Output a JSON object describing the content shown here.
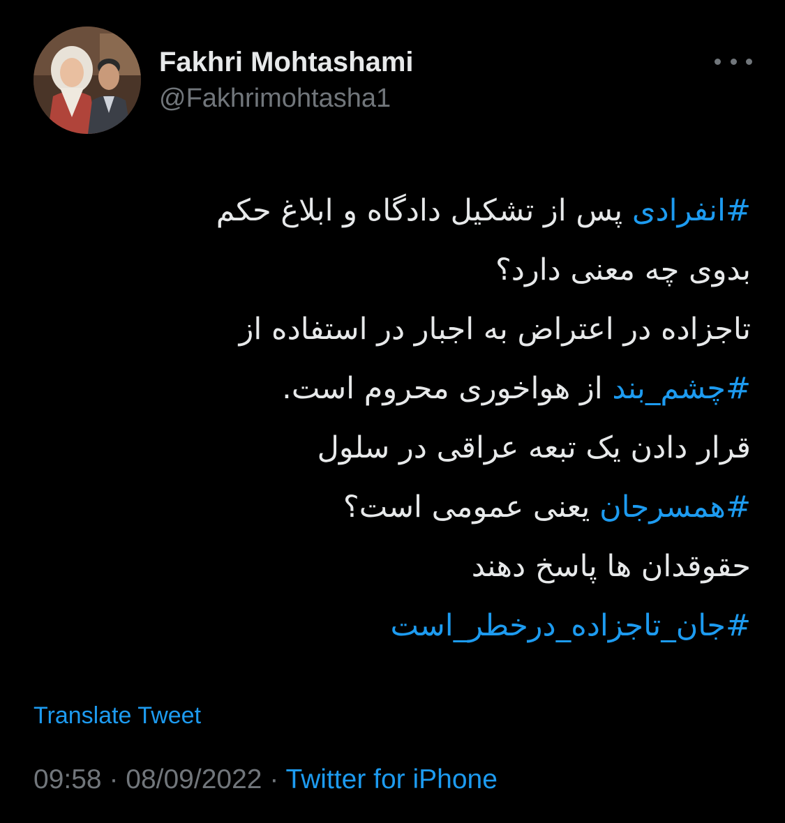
{
  "author": {
    "display_name": "Fakhri Mohtashami",
    "handle": "@Fakhrimohtasha1",
    "avatar_icon": "profile-photo-icon"
  },
  "more_icon": "more-horizontal-icon",
  "tweet": {
    "lines": [
      {
        "hashtag": "#انفرادی",
        "text": " پس از تشکیل دادگاه و ابلاغ حکم"
      },
      {
        "text": "بدوی چه معنی دارد؟"
      },
      {
        "text": "تاجزاده در اعتراض به اجبار در استفاده از"
      },
      {
        "hashtag": "#چشم_بند",
        "text": " از هواخوری محروم است."
      },
      {
        "text": "قرار دادن یک تبعه عراقی در سلول"
      },
      {
        "hashtag": "#همسرجان",
        "text": " یعنی عمومی است؟"
      },
      {
        "text": "حقوقدان ها پاسخ دهند"
      },
      {
        "hashtag": "#جان_تاجزاده_درخطر_است"
      }
    ]
  },
  "translate_label": "Translate Tweet",
  "meta": {
    "time": "09:58",
    "separator": " · ",
    "date": "08/09/2022",
    "source": "Twitter for iPhone"
  },
  "colors": {
    "background": "#000000",
    "text": "#e7e9ea",
    "secondary": "#71767b",
    "link": "#1d9bf0"
  }
}
